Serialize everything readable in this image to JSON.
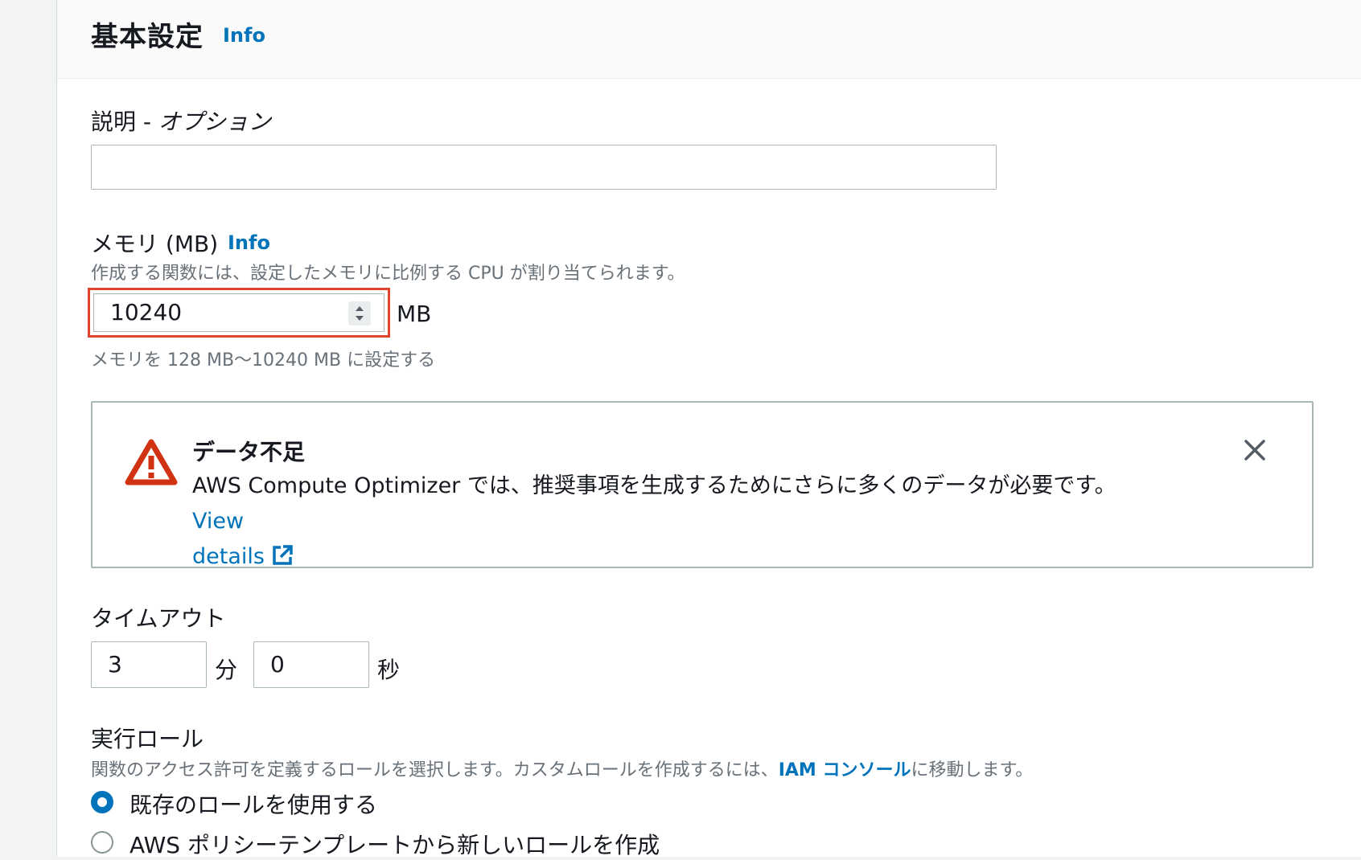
{
  "header": {
    "title": "基本設定",
    "info": "Info"
  },
  "description": {
    "label": "説明 - ",
    "label_optional": "オプション",
    "value": ""
  },
  "memory": {
    "label": "メモリ (MB)",
    "info": "Info",
    "description": "作成する関数には、設定したメモリに比例する CPU が割り当てられます。",
    "value": "10240",
    "unit": "MB",
    "constraint": "メモリを 128 MB〜10240 MB に設定する"
  },
  "alert": {
    "title": "データ不足",
    "body": "AWS Compute Optimizer では、推奨事項を生成するためにさらに多くのデータが必要です。",
    "link_text_1": "View",
    "link_text_2": "details",
    "icon": "warning-icon",
    "status_color": "#d13212"
  },
  "timeout": {
    "label": "タイムアウト",
    "minutes": "3",
    "minutes_unit": "分",
    "seconds": "0",
    "seconds_unit": "秒"
  },
  "role": {
    "label": "実行ロール",
    "description_pre": "関数のアクセス許可を定義するロールを選択します。カスタムロールを作成するには、",
    "link": "IAM コンソール",
    "description_post": "に移動します。",
    "options": [
      {
        "label": "既存のロールを使用する",
        "selected": true
      },
      {
        "label": "AWS ポリシーテンプレートから新しいロールを作成",
        "selected": false
      }
    ]
  },
  "colors": {
    "accent": "#0073bb",
    "highlight_border": "#e0432d"
  }
}
